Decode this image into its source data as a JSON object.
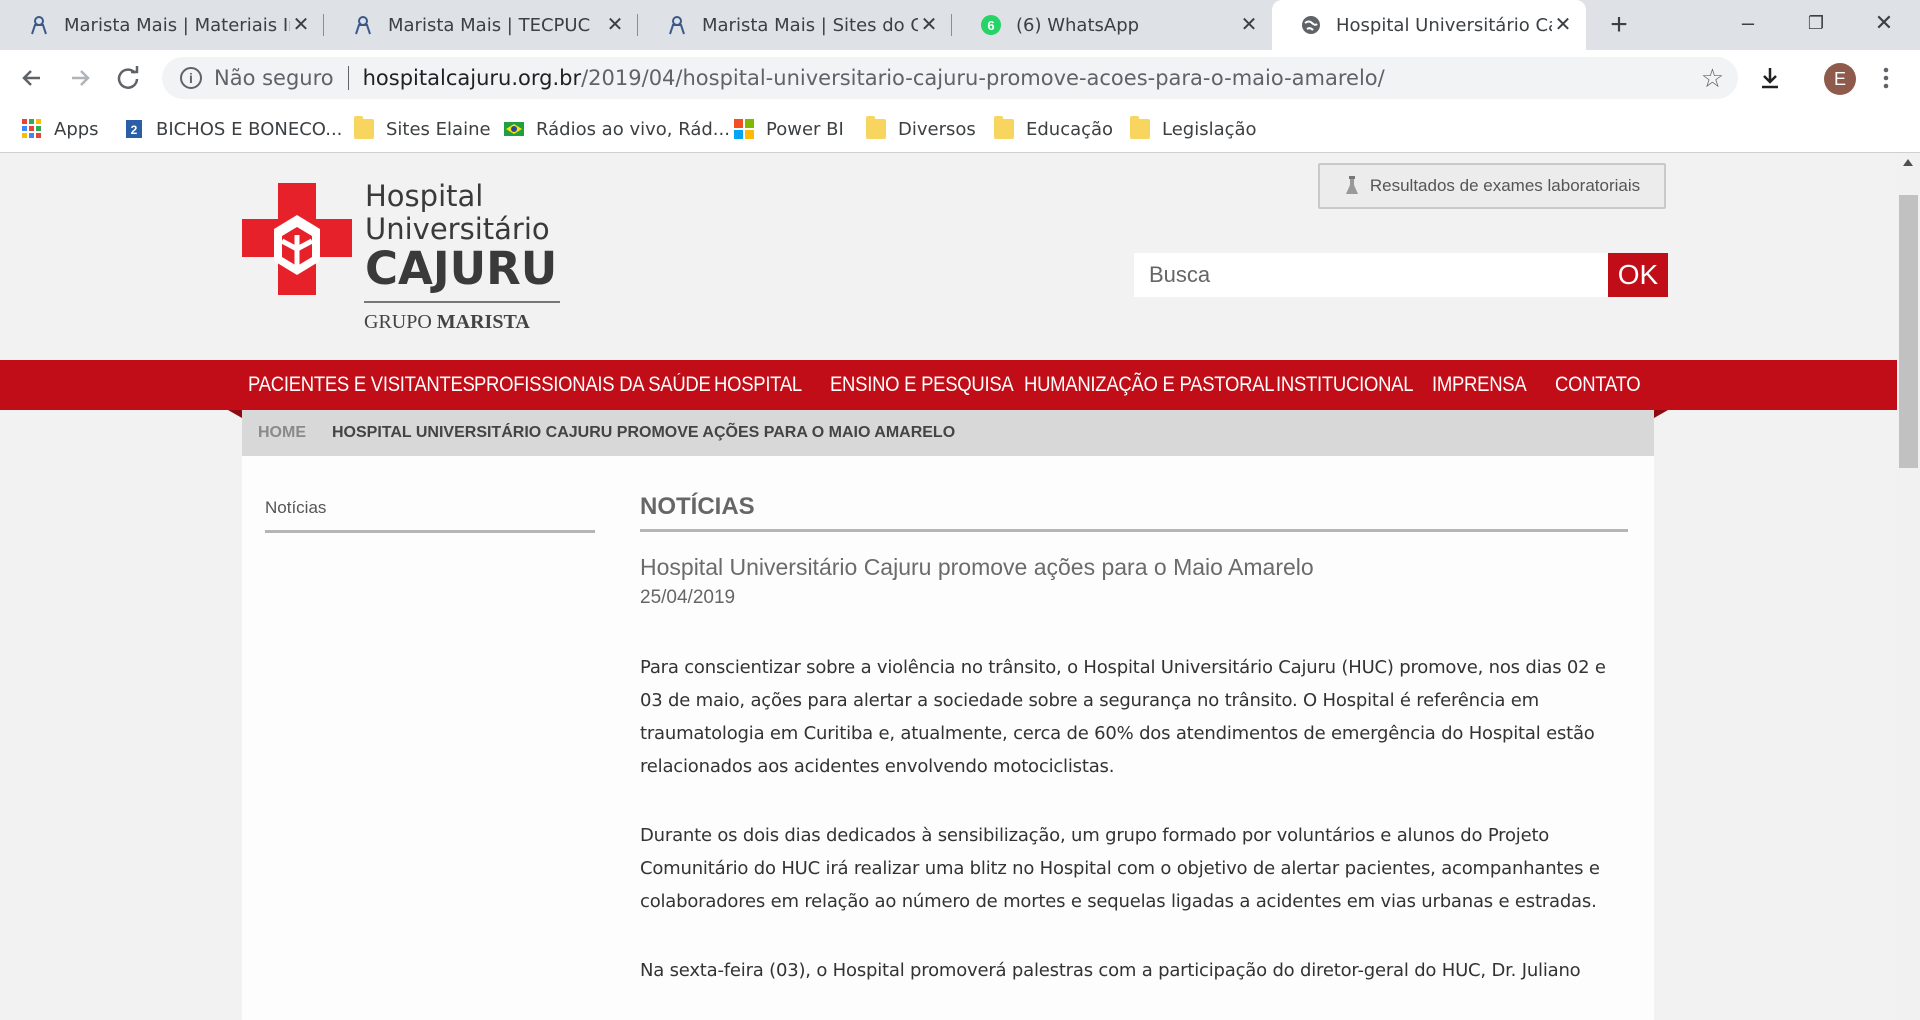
{
  "browser": {
    "tabs": [
      {
        "title": "Marista Mais | Materiais Institucionais",
        "icon": "marista-icon",
        "active": false
      },
      {
        "title": "Marista Mais | TECPUC",
        "icon": "marista-icon",
        "active": false
      },
      {
        "title": "Marista Mais | Sites do Grupo",
        "icon": "marista-icon",
        "active": false
      },
      {
        "title": "(6) WhatsApp",
        "icon": "whatsapp-icon",
        "badge": "6",
        "active": false
      },
      {
        "title": "Hospital Universitário Cajuru",
        "icon": "globe-icon",
        "active": true
      }
    ],
    "new_tab": "+",
    "window_controls": {
      "minimize": "–",
      "restore": "❐",
      "close": "✕"
    },
    "address": {
      "security_label": "Não seguro",
      "host": "hospitalcajuru.org.br",
      "path": "/2019/04/hospital-universitario-cajuru-promove-acoes-para-o-maio-amarelo/"
    },
    "profile_initial": "E",
    "bookmarks": [
      {
        "label": "Apps",
        "icon": "apps-grid-icon"
      },
      {
        "label": "BICHOS E BONECO...",
        "icon": "bookmark-site-icon"
      },
      {
        "label": "Sites Elaine",
        "icon": "folder-icon"
      },
      {
        "label": "Rádios ao vivo, Rád...",
        "icon": "brazil-flag-icon"
      },
      {
        "label": "Power BI",
        "icon": "windows-logo-icon"
      },
      {
        "label": "Diversos",
        "icon": "folder-icon"
      },
      {
        "label": "Educação",
        "icon": "folder-icon"
      },
      {
        "label": "Legislação",
        "icon": "folder-icon"
      }
    ]
  },
  "site": {
    "logo": {
      "line1": "Hospital",
      "line2": "Universitário",
      "line3": "CAJURU",
      "group_prefix": "GRUPO",
      "group_name": "MARISTA"
    },
    "exam_button": "Resultados de exames laboratoriais",
    "search": {
      "placeholder": "Busca",
      "submit": "OK"
    },
    "nav": [
      "Pacientes e Visitantes",
      "Profissionais da Saúde",
      "Hospital",
      "Ensino e Pesquisa",
      "Humanização e Pastoral",
      "Institucional",
      "Imprensa",
      "Contato"
    ],
    "breadcrumb": {
      "home": "HOME",
      "current": "HOSPITAL UNIVERSITÁRIO CAJURU PROMOVE AÇÕES PARA O MAIO AMARELO"
    },
    "sidebar": {
      "label": "Notícias"
    },
    "article": {
      "section": "NOTÍCIAS",
      "title": "Hospital Universitário Cajuru promove ações para o Maio Amarelo",
      "date": "25/04/2019",
      "paragraphs": [
        "Para conscientizar sobre a violência no trânsito, o Hospital Universitário Cajuru (HUC) promove, nos dias 02 e 03 de maio, ações para alertar a sociedade sobre a segurança no trânsito. O Hospital é referência em traumatologia em Curitiba e, atualmente, cerca de 60% dos atendimentos de emergência do Hospital estão relacionados aos acidentes envolvendo motociclistas.",
        "Durante os dois dias dedicados à sensibilização, um grupo formado por voluntários e alunos do Projeto Comunitário do HUC irá realizar uma blitz no Hospital com o objetivo de alertar pacientes, acompanhantes e colaboradores em relação ao número de mortes e sequelas ligadas a acidentes em vias urbanas e estradas.",
        "Na sexta-feira (03), o Hospital promoverá palestras com a participação do diretor-geral do HUC, Dr. Juliano"
      ]
    }
  },
  "colors": {
    "brand_red": "#c00d17",
    "tabstrip": "#dee1e6"
  }
}
